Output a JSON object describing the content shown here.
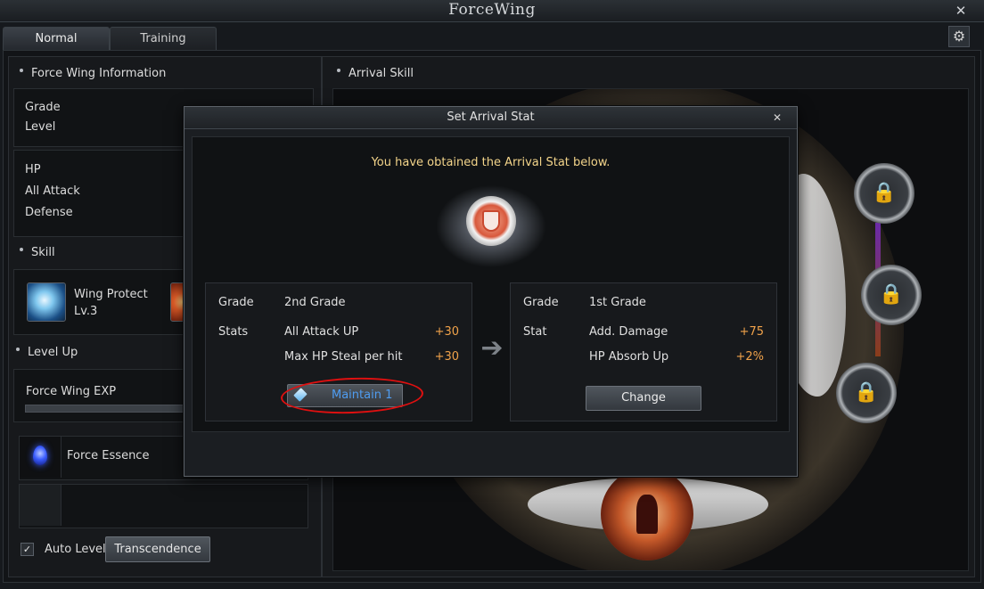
{
  "window": {
    "title": "ForceWing"
  },
  "tabs": [
    {
      "label": "Normal"
    },
    {
      "label": "Training"
    }
  ],
  "left": {
    "info_title": "Force Wing Information",
    "grade_label": "Grade",
    "level_label": "Level",
    "hp_label": "HP",
    "all_attack_label": "All Attack",
    "defense_label": "Defense",
    "skill_title": "Skill",
    "skill_name": "Wing Protect",
    "skill_level": "Lv.3",
    "levelup_title": "Level Up",
    "exp_label": "Force Wing EXP",
    "essence_label": "Force Essence",
    "auto_level_label": "Auto Level UP",
    "auto_level_checked": true,
    "transcendence_label": "Transcendence"
  },
  "right": {
    "arrival_skill_title": "Arrival Skill"
  },
  "dialog": {
    "title": "Set Arrival Stat",
    "message": "You have obtained the Arrival Stat below.",
    "current": {
      "grade_label": "Grade",
      "grade_value": "2nd Grade",
      "stats_label": "Stats",
      "stats": [
        {
          "name": "All Attack UP",
          "value": "+30"
        },
        {
          "name": "Max HP Steal per hit",
          "value": "+30"
        }
      ],
      "maintain_label": "Maintain 1"
    },
    "new": {
      "grade_label": "Grade",
      "grade_value": "1st Grade",
      "stat_label": "Stat",
      "stats": [
        {
          "name": "Add. Damage",
          "value": "+75"
        },
        {
          "name": "HP Absorb Up",
          "value": "+2%"
        }
      ],
      "change_label": "Change"
    }
  },
  "colors": {
    "accent_orange": "#f0a24a",
    "message_gold": "#f3d48a",
    "maintain_blue": "#4f9cf0",
    "highlight_red": "#e01010"
  }
}
